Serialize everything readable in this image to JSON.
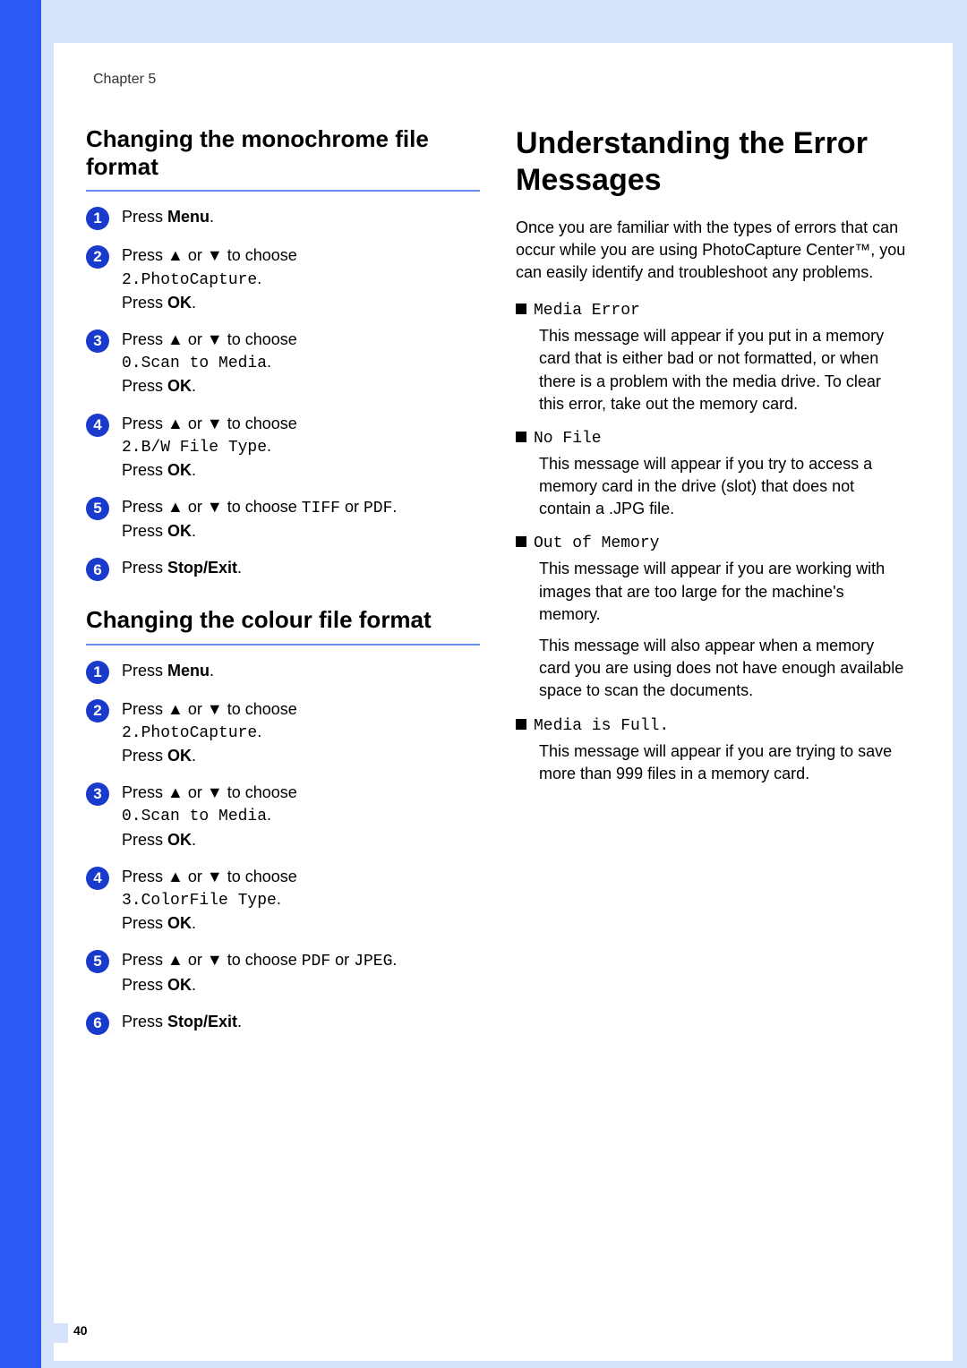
{
  "chapter": "Chapter 5",
  "pageNumber": "40",
  "left": {
    "sectionA": {
      "title": "Changing the monochrome file format",
      "steps": [
        {
          "n": "1",
          "lines": [
            [
              {
                "t": "Press "
              },
              {
                "t": "Menu",
                "b": true
              },
              {
                "t": "."
              }
            ]
          ]
        },
        {
          "n": "2",
          "lines": [
            [
              {
                "t": "Press "
              },
              {
                "t": "▲",
                "a": true
              },
              {
                "t": " or "
              },
              {
                "t": "▼",
                "a": true
              },
              {
                "t": " to choose"
              }
            ],
            [
              {
                "t": "2.PhotoCapture",
                "m": true
              },
              {
                "t": "."
              }
            ],
            [
              {
                "t": "Press "
              },
              {
                "t": "OK",
                "b": true
              },
              {
                "t": "."
              }
            ]
          ]
        },
        {
          "n": "3",
          "lines": [
            [
              {
                "t": "Press "
              },
              {
                "t": "▲",
                "a": true
              },
              {
                "t": " or "
              },
              {
                "t": "▼",
                "a": true
              },
              {
                "t": " to choose"
              }
            ],
            [
              {
                "t": "0.Scan to Media",
                "m": true
              },
              {
                "t": "."
              }
            ],
            [
              {
                "t": "Press "
              },
              {
                "t": "OK",
                "b": true
              },
              {
                "t": "."
              }
            ]
          ]
        },
        {
          "n": "4",
          "lines": [
            [
              {
                "t": "Press "
              },
              {
                "t": "▲",
                "a": true
              },
              {
                "t": " or "
              },
              {
                "t": "▼",
                "a": true
              },
              {
                "t": " to choose"
              }
            ],
            [
              {
                "t": "2.B/W File Type",
                "m": true
              },
              {
                "t": "."
              }
            ],
            [
              {
                "t": "Press "
              },
              {
                "t": "OK",
                "b": true
              },
              {
                "t": "."
              }
            ]
          ]
        },
        {
          "n": "5",
          "lines": [
            [
              {
                "t": "Press "
              },
              {
                "t": "▲",
                "a": true
              },
              {
                "t": " or "
              },
              {
                "t": "▼",
                "a": true
              },
              {
                "t": " to choose "
              },
              {
                "t": "TIFF",
                "m": true
              },
              {
                "t": " or "
              },
              {
                "t": "PDF",
                "m": true
              },
              {
                "t": "."
              }
            ],
            [
              {
                "t": "Press "
              },
              {
                "t": "OK",
                "b": true
              },
              {
                "t": "."
              }
            ]
          ]
        },
        {
          "n": "6",
          "lines": [
            [
              {
                "t": "Press "
              },
              {
                "t": "Stop/Exit",
                "b": true
              },
              {
                "t": "."
              }
            ]
          ]
        }
      ]
    },
    "sectionB": {
      "title": "Changing the colour file format",
      "steps": [
        {
          "n": "1",
          "lines": [
            [
              {
                "t": "Press "
              },
              {
                "t": "Menu",
                "b": true
              },
              {
                "t": "."
              }
            ]
          ]
        },
        {
          "n": "2",
          "lines": [
            [
              {
                "t": "Press "
              },
              {
                "t": "▲",
                "a": true
              },
              {
                "t": " or "
              },
              {
                "t": "▼",
                "a": true
              },
              {
                "t": " to choose"
              }
            ],
            [
              {
                "t": "2.PhotoCapture",
                "m": true
              },
              {
                "t": "."
              }
            ],
            [
              {
                "t": "Press "
              },
              {
                "t": "OK",
                "b": true
              },
              {
                "t": "."
              }
            ]
          ]
        },
        {
          "n": "3",
          "lines": [
            [
              {
                "t": "Press "
              },
              {
                "t": "▲",
                "a": true
              },
              {
                "t": " or "
              },
              {
                "t": "▼",
                "a": true
              },
              {
                "t": " to choose"
              }
            ],
            [
              {
                "t": "0.Scan to Media",
                "m": true
              },
              {
                "t": "."
              }
            ],
            [
              {
                "t": "Press "
              },
              {
                "t": "OK",
                "b": true
              },
              {
                "t": "."
              }
            ]
          ]
        },
        {
          "n": "4",
          "lines": [
            [
              {
                "t": "Press "
              },
              {
                "t": "▲",
                "a": true
              },
              {
                "t": " or "
              },
              {
                "t": "▼",
                "a": true
              },
              {
                "t": " to choose"
              }
            ],
            [
              {
                "t": "3.ColorFile Type",
                "m": true
              },
              {
                "t": "."
              }
            ],
            [
              {
                "t": "Press "
              },
              {
                "t": "OK",
                "b": true
              },
              {
                "t": "."
              }
            ]
          ]
        },
        {
          "n": "5",
          "lines": [
            [
              {
                "t": "Press "
              },
              {
                "t": "▲",
                "a": true
              },
              {
                "t": " or "
              },
              {
                "t": "▼",
                "a": true
              },
              {
                "t": " to choose "
              },
              {
                "t": "PDF",
                "m": true
              },
              {
                "t": " or "
              },
              {
                "t": "JPEG",
                "m": true
              },
              {
                "t": "."
              }
            ],
            [
              {
                "t": "Press "
              },
              {
                "t": "OK",
                "b": true
              },
              {
                "t": "."
              }
            ]
          ]
        },
        {
          "n": "6",
          "lines": [
            [
              {
                "t": "Press "
              },
              {
                "t": "Stop/Exit",
                "b": true
              },
              {
                "t": "."
              }
            ]
          ]
        }
      ]
    }
  },
  "right": {
    "title": "Understanding the Error Messages",
    "intro": "Once you are familiar with the types of errors that can occur while you are using PhotoCapture Center™, you can easily identify and troubleshoot any problems.",
    "errors": [
      {
        "name": "Media Error",
        "paras": [
          "This message will appear if you put in a memory card that is either bad or not formatted, or when there is a problem with the media drive. To clear this error, take out the memory card."
        ]
      },
      {
        "name": "No File",
        "paras": [
          "This message will appear if you try to access a memory card in the drive (slot) that does not contain a .JPG file."
        ]
      },
      {
        "name": "Out of Memory",
        "paras": [
          "This message will appear if you are working with images that are too large for the machine's memory.",
          "This message will also appear when a memory card you are using does not have enough available space to scan the documents."
        ]
      },
      {
        "name": "Media is Full.",
        "paras": [
          "This message will appear if you are trying to save more than 999 files in a memory card."
        ]
      }
    ]
  }
}
